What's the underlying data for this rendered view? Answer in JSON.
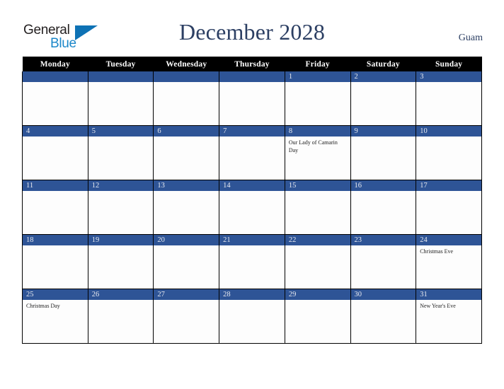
{
  "brand": {
    "name_part1": "General",
    "name_part2": "Blue"
  },
  "header": {
    "title": "December 2028",
    "region": "Guam"
  },
  "calendar": {
    "weekday_headers": [
      "Monday",
      "Tuesday",
      "Wednesday",
      "Thursday",
      "Friday",
      "Saturday",
      "Sunday"
    ],
    "colors": {
      "header_background": "#000000",
      "header_text": "#ffffff",
      "day_band": "#2e5496",
      "day_band_text": "#e8eaf0",
      "title_text": "#2c3f63",
      "cell_background": "#fdfdfd",
      "grid_line": "#000000"
    },
    "weeks": [
      [
        {
          "day": "",
          "event": ""
        },
        {
          "day": "",
          "event": ""
        },
        {
          "day": "",
          "event": ""
        },
        {
          "day": "",
          "event": ""
        },
        {
          "day": "1",
          "event": ""
        },
        {
          "day": "2",
          "event": ""
        },
        {
          "day": "3",
          "event": ""
        }
      ],
      [
        {
          "day": "4",
          "event": ""
        },
        {
          "day": "5",
          "event": ""
        },
        {
          "day": "6",
          "event": ""
        },
        {
          "day": "7",
          "event": ""
        },
        {
          "day": "8",
          "event": "Our Lady of Camarin Day"
        },
        {
          "day": "9",
          "event": ""
        },
        {
          "day": "10",
          "event": ""
        }
      ],
      [
        {
          "day": "11",
          "event": ""
        },
        {
          "day": "12",
          "event": ""
        },
        {
          "day": "13",
          "event": ""
        },
        {
          "day": "14",
          "event": ""
        },
        {
          "day": "15",
          "event": ""
        },
        {
          "day": "16",
          "event": ""
        },
        {
          "day": "17",
          "event": ""
        }
      ],
      [
        {
          "day": "18",
          "event": ""
        },
        {
          "day": "19",
          "event": ""
        },
        {
          "day": "20",
          "event": ""
        },
        {
          "day": "21",
          "event": ""
        },
        {
          "day": "22",
          "event": ""
        },
        {
          "day": "23",
          "event": ""
        },
        {
          "day": "24",
          "event": "Christmas Eve"
        }
      ],
      [
        {
          "day": "25",
          "event": "Christmas Day"
        },
        {
          "day": "26",
          "event": ""
        },
        {
          "day": "27",
          "event": ""
        },
        {
          "day": "28",
          "event": ""
        },
        {
          "day": "29",
          "event": ""
        },
        {
          "day": "30",
          "event": ""
        },
        {
          "day": "31",
          "event": "New Year's Eve"
        }
      ]
    ]
  }
}
